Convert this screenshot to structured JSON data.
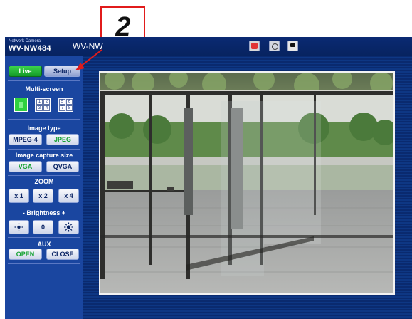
{
  "callout": {
    "number": "2"
  },
  "header": {
    "brand_line": "Network Camera",
    "model": "WV-NW484",
    "model_repeat": "WV-NW"
  },
  "toolbar": {
    "icons": [
      "record-icon",
      "display-mode-icon",
      "snapshot-icon"
    ]
  },
  "tabs": {
    "live": "Live",
    "setup": "Setup"
  },
  "multiscreen": {
    "title": "Multi-screen",
    "option_single": "1",
    "option_quad_1": [
      "1",
      "2",
      "3",
      "4"
    ],
    "option_quad_2": [
      "5",
      "6",
      "7",
      "8"
    ]
  },
  "image_type": {
    "title": "Image type",
    "mpeg4": "MPEG-4",
    "jpeg": "JPEG"
  },
  "capture_size": {
    "title": "Image capture size",
    "vga": "VGA",
    "qvga": "QVGA"
  },
  "zoom": {
    "title": "ZOOM",
    "x1": "x 1",
    "x2": "x 2",
    "x4": "x 4"
  },
  "brightness": {
    "title": "-  Brightness  +",
    "reset": "0"
  },
  "aux": {
    "title": "AUX",
    "open": "OPEN",
    "close": "CLOSE"
  },
  "colors": {
    "accent_green": "#16a233",
    "panel_blue": "#1a46a0",
    "frame_bg": "#0b2c78",
    "callout_red": "#e11b1b"
  }
}
